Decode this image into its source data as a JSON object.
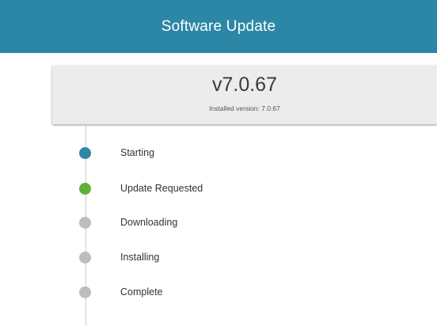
{
  "header": {
    "title": "Software Update"
  },
  "version_card": {
    "version": "v7.0.67",
    "installed_text": "Installed version: 7.0.67"
  },
  "steps": [
    {
      "label": "Starting",
      "status": "active",
      "color": "#2c87a6"
    },
    {
      "label": "Update Requested",
      "status": "done",
      "color": "#5db335"
    },
    {
      "label": "Downloading",
      "status": "pending",
      "color": "#bdbdbd"
    },
    {
      "label": "Installing",
      "status": "pending",
      "color": "#bdbdbd"
    },
    {
      "label": "Complete",
      "status": "pending",
      "color": "#bdbdbd"
    }
  ],
  "colors": {
    "header_bg": "#2c87a6",
    "card_bg": "#ececec",
    "timeline": "#cfcfcf"
  }
}
